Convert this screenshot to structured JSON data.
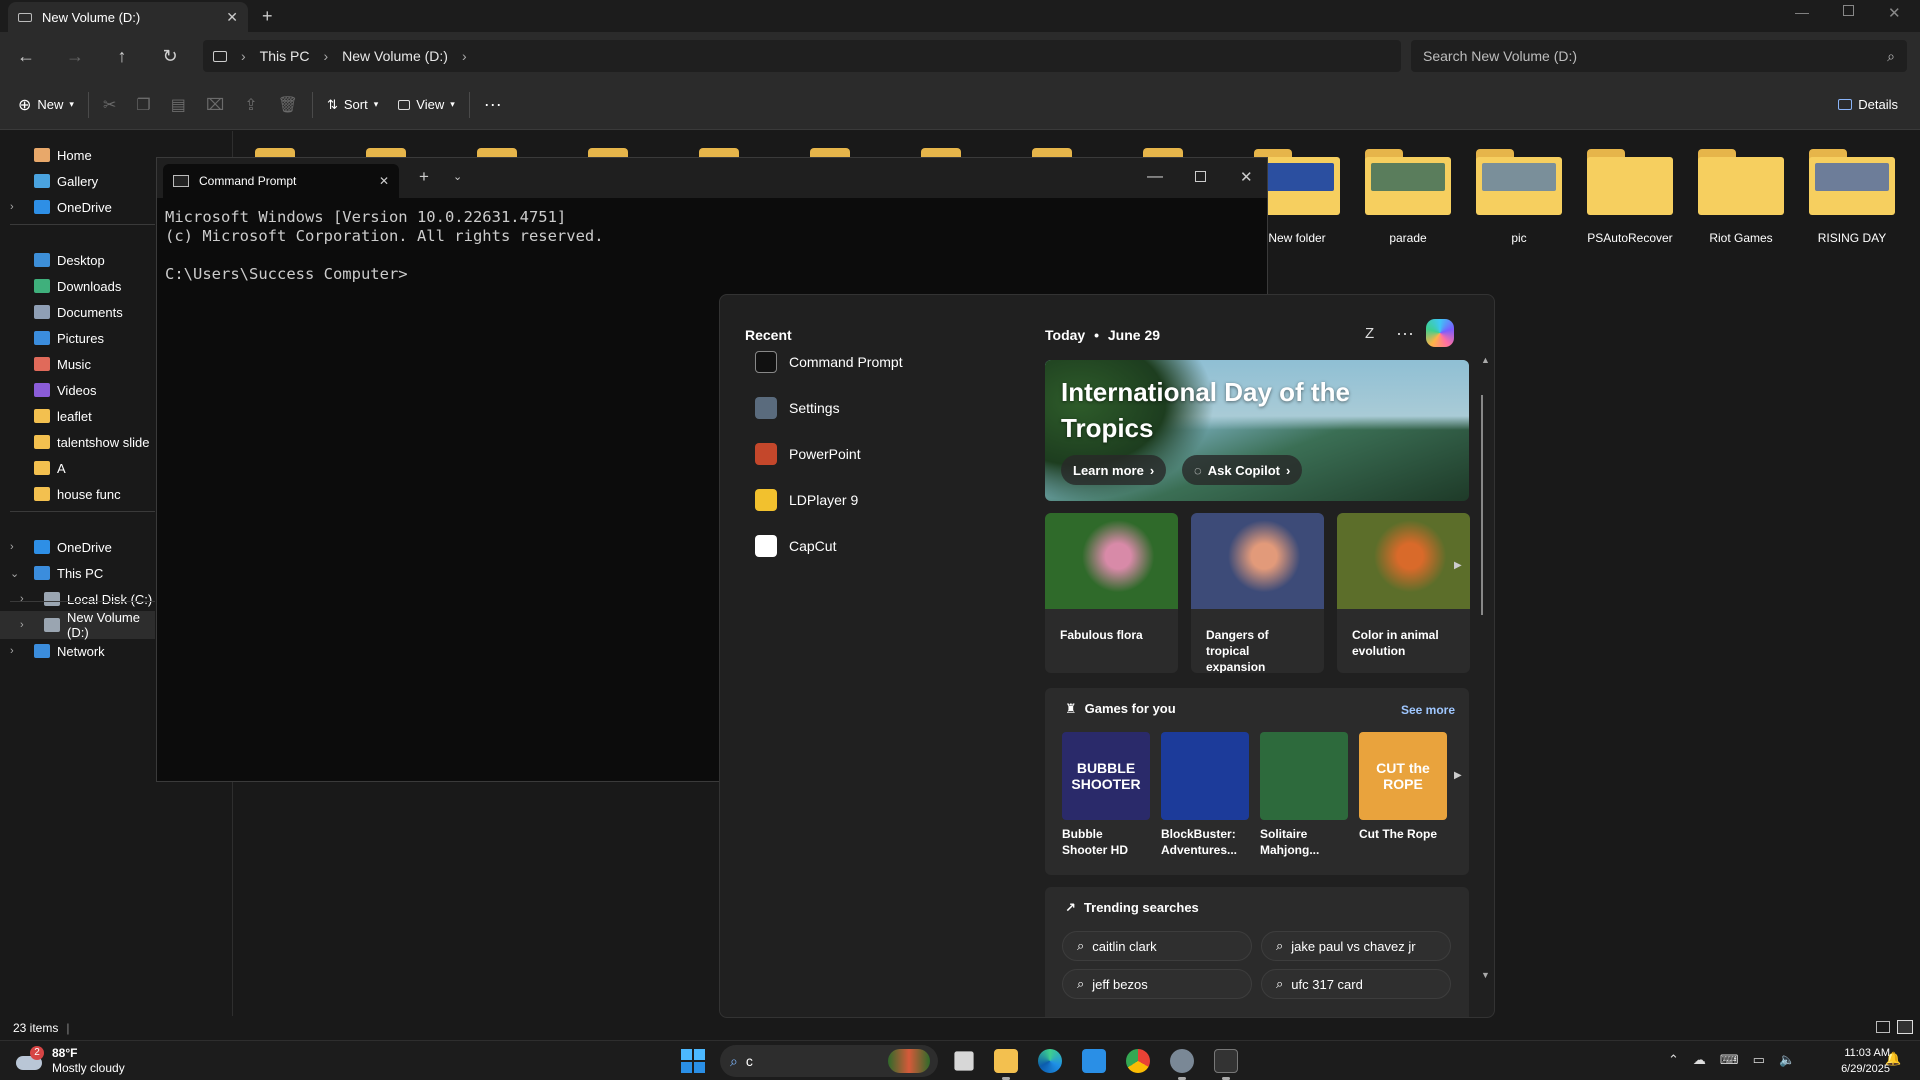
{
  "explorer": {
    "tab_title": "New Volume (D:)",
    "breadcrumb": [
      "This PC",
      "New Volume (D:)"
    ],
    "search_placeholder": "Search New Volume (D:)",
    "toolbar": {
      "new": "New",
      "sort": "Sort",
      "view": "View",
      "details": "Details"
    },
    "sidebar": [
      {
        "label": "Home",
        "color": "#e8a86a"
      },
      {
        "label": "Gallery",
        "color": "#4aa3df"
      },
      {
        "label": "OneDrive",
        "color": "#2e8fe6"
      },
      {
        "label": "Desktop",
        "color": "#3d8fd8"
      },
      {
        "label": "Downloads",
        "color": "#3fb07c"
      },
      {
        "label": "Documents",
        "color": "#8f9fb5"
      },
      {
        "label": "Pictures",
        "color": "#3b8ddd"
      },
      {
        "label": "Music",
        "color": "#e06a5a"
      },
      {
        "label": "Videos",
        "color": "#8a5cd8"
      },
      {
        "label": "leaflet",
        "color": "#f3c04f"
      },
      {
        "label": "talentshow slide",
        "color": "#f3c04f"
      },
      {
        "label": "A",
        "color": "#f3c04f"
      },
      {
        "label": "house func",
        "color": "#f3c04f"
      },
      {
        "label": "OneDrive",
        "color": "#2e8fe6"
      },
      {
        "label": "This PC",
        "color": "#3b8ddd"
      },
      {
        "label": "Local Disk (C:)",
        "color": "#9aa5b1"
      },
      {
        "label": "New Volume (D:)",
        "color": "#9aa5b1"
      },
      {
        "label": "Network",
        "color": "#3b8ddd"
      }
    ],
    "folders": [
      "New folder",
      "parade",
      "pic",
      "PSAutoRecover",
      "Riot Games",
      "RISING DAY"
    ],
    "status": "23 items"
  },
  "cmd": {
    "tab_title": "Command Prompt",
    "lines": [
      "Microsoft Windows [Version 10.0.22631.4751]",
      "(c) Microsoft Corporation. All rights reserved.",
      "",
      "C:\\Users\\Success Computer>"
    ]
  },
  "start": {
    "recent_title": "Recent",
    "recent": [
      {
        "label": "Command Prompt",
        "icon": "cmd-icon",
        "color": "#111111"
      },
      {
        "label": "Settings",
        "icon": "gear-icon",
        "color": "#5a6b7d"
      },
      {
        "label": "PowerPoint",
        "icon": "powerpoint-icon",
        "color": "#c4472b"
      },
      {
        "label": "LDPlayer 9",
        "icon": "ldplayer-icon",
        "color": "#f2c12e"
      },
      {
        "label": "CapCut",
        "icon": "capcut-icon",
        "color": "#ffffff"
      }
    ],
    "today": "Today",
    "date": "June 29",
    "avatar_letter": "Z",
    "hero_title": "International Day of the Tropics",
    "learn_more": "Learn more",
    "ask_copilot": "Ask Copilot",
    "cards": [
      {
        "caption": "Fabulous flora",
        "colors": [
          "#2f6a2a",
          "#d88aa8"
        ]
      },
      {
        "caption": "Dangers of tropical expansion",
        "colors": [
          "#3d4b78",
          "#e29a7a"
        ]
      },
      {
        "caption": "Color in animal evolution",
        "colors": [
          "#5c6e2a",
          "#d96a2a"
        ]
      }
    ],
    "games_title": "Games for you",
    "see_more": "See more",
    "games": [
      {
        "title": "Bubble Shooter HD",
        "art": "BUBBLE SHOOTER",
        "color": "#2a2a6a"
      },
      {
        "title": "BlockBuster: Adventures...",
        "art": "",
        "color": "#1c3b9a"
      },
      {
        "title": "Solitaire Mahjong...",
        "art": "",
        "color": "#2d6a3c"
      },
      {
        "title": "Cut The Rope",
        "art": "CUT the ROPE",
        "color": "#e9a33d"
      }
    ],
    "trending_title": "Trending searches",
    "trending": [
      "caitlin clark",
      "jake paul vs chavez jr",
      "jeff bezos",
      "ufc 317 card"
    ]
  },
  "taskbar": {
    "weather_temp": "88°F",
    "weather_desc": "Mostly cloudy",
    "weather_badge": "2",
    "search_value": "c",
    "time": "11:03 AM",
    "date": "6/29/2025"
  }
}
